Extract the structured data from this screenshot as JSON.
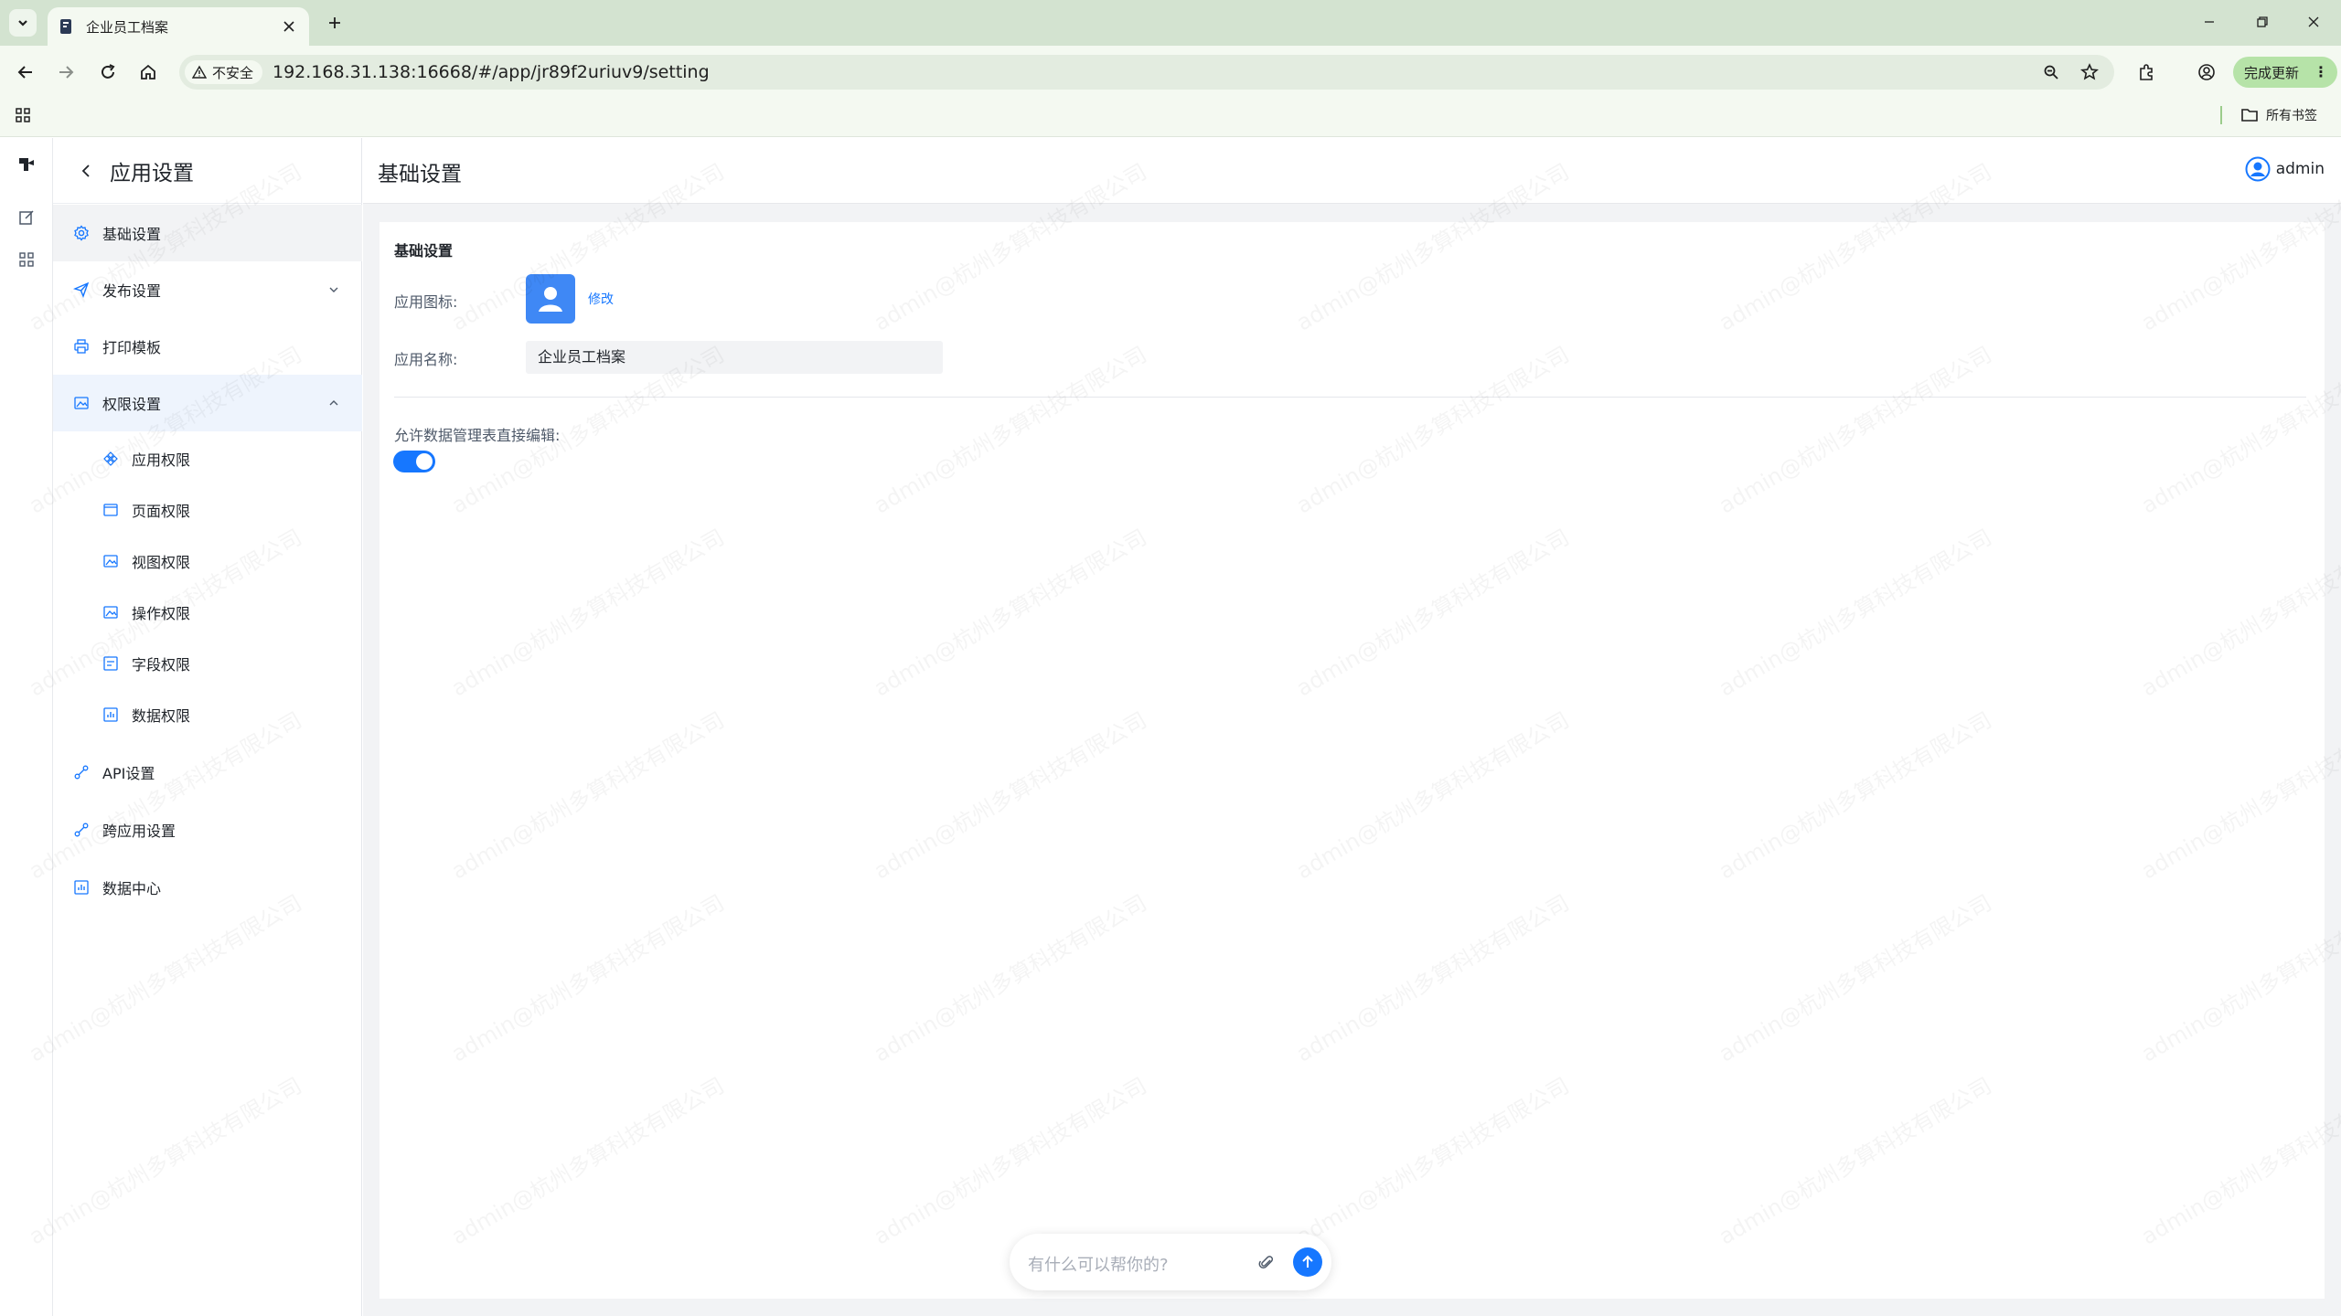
{
  "browser": {
    "tab_title": "企业员工档案",
    "insecure_label": "不安全",
    "url": "192.168.31.138:16668/#/app/jr89f2uriuv9/setting",
    "update_label": "完成更新",
    "all_bookmarks_label": "所有书签"
  },
  "sidebar": {
    "title": "应用设置",
    "items": [
      {
        "label": "基础设置",
        "icon": "gear-icon"
      },
      {
        "label": "发布设置",
        "icon": "paper-plane-icon"
      },
      {
        "label": "打印模板",
        "icon": "printer-icon"
      },
      {
        "label": "权限设置",
        "icon": "image-lock-icon"
      }
    ],
    "sub_items": [
      {
        "label": "应用权限",
        "icon": "apps-icon"
      },
      {
        "label": "页面权限",
        "icon": "page-icon"
      },
      {
        "label": "视图权限",
        "icon": "image-icon"
      },
      {
        "label": "操作权限",
        "icon": "image-icon"
      },
      {
        "label": "字段权限",
        "icon": "list-icon"
      },
      {
        "label": "数据权限",
        "icon": "data-chart-icon"
      }
    ],
    "bottom_items": [
      {
        "label": "API设置",
        "icon": "link-icon"
      },
      {
        "label": "跨应用设置",
        "icon": "link-icon"
      },
      {
        "label": "数据中心",
        "icon": "data-chart-icon"
      }
    ]
  },
  "main": {
    "title": "基础设置",
    "user_name": "admin",
    "section_title": "基础设置",
    "icon_label": "应用图标:",
    "modify_label": "修改",
    "name_label": "应用名称:",
    "name_value": "企业员工档案",
    "allow_edit_label": "允许数据管理表直接编辑:",
    "allow_edit_value": true
  },
  "watermark_text": "admin@杭州多算科技有限公司",
  "chat": {
    "placeholder": "有什么可以帮你的?"
  },
  "colors": {
    "accent": "#1677ff",
    "chrome": "#d3e3d0",
    "update_button": "#b6e3a8"
  }
}
